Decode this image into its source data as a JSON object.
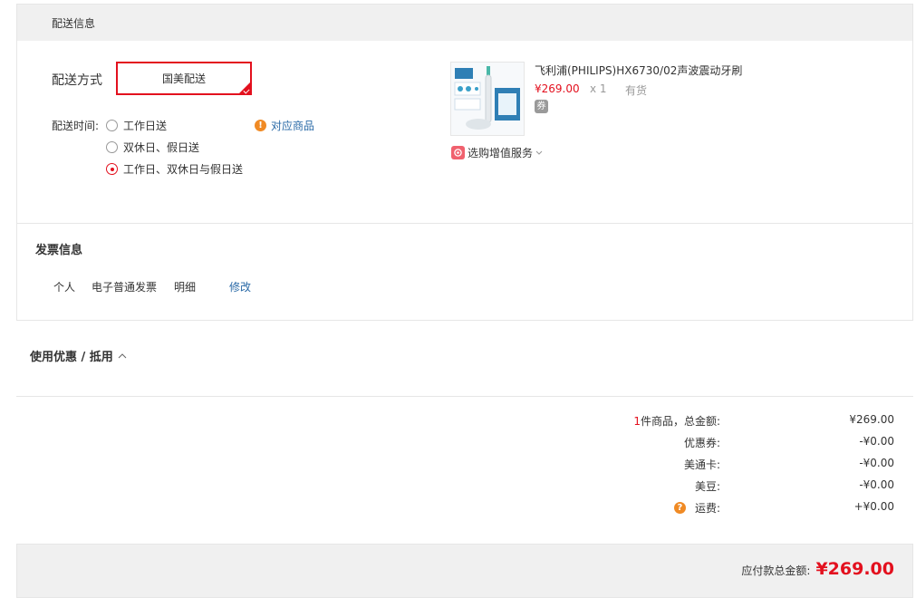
{
  "delivery": {
    "header_title": "配送信息",
    "method_label": "配送方式",
    "method_value": "国美配送",
    "time_label": "配送时间:",
    "time_options": [
      {
        "label": "工作日送",
        "checked": false
      },
      {
        "label": "双休日、假日送",
        "checked": false
      },
      {
        "label": "工作日、双休日与假日送",
        "checked": true
      }
    ],
    "warn_icon": "!",
    "related_products_link": "对应商品",
    "product": {
      "name": "飞利浦(PHILIPS)HX6730/02声波震动牙刷",
      "price": "¥269.00",
      "quantity": "x 1",
      "stock": "有货",
      "tag_icon": "券",
      "value_added_service": "选购增值服务"
    }
  },
  "invoice": {
    "title": "发票信息",
    "type_personal": "个人",
    "kind": "电子普通发票",
    "detail": "明细",
    "edit_link": "修改"
  },
  "coupons": {
    "title": "使用优惠 / 抵用"
  },
  "summary": {
    "count": "1",
    "count_suffix": "件商品，总金额:",
    "total_amount": "¥269.00",
    "coupon_label": "优惠券:",
    "coupon_value": "-¥0.00",
    "meitong_label": "美通卡:",
    "meitong_value": "-¥0.00",
    "beans_label": "美豆:",
    "beans_value": "-¥0.00",
    "question_icon": "?",
    "shipping_label": "运费:",
    "shipping_value": "+¥0.00"
  },
  "total": {
    "label": "应付款总金额:",
    "value": "¥269.00"
  },
  "colors": {
    "accent_red": "#e3101e",
    "link_blue": "#2a6aa7",
    "warning_orange": "#f08a24"
  }
}
